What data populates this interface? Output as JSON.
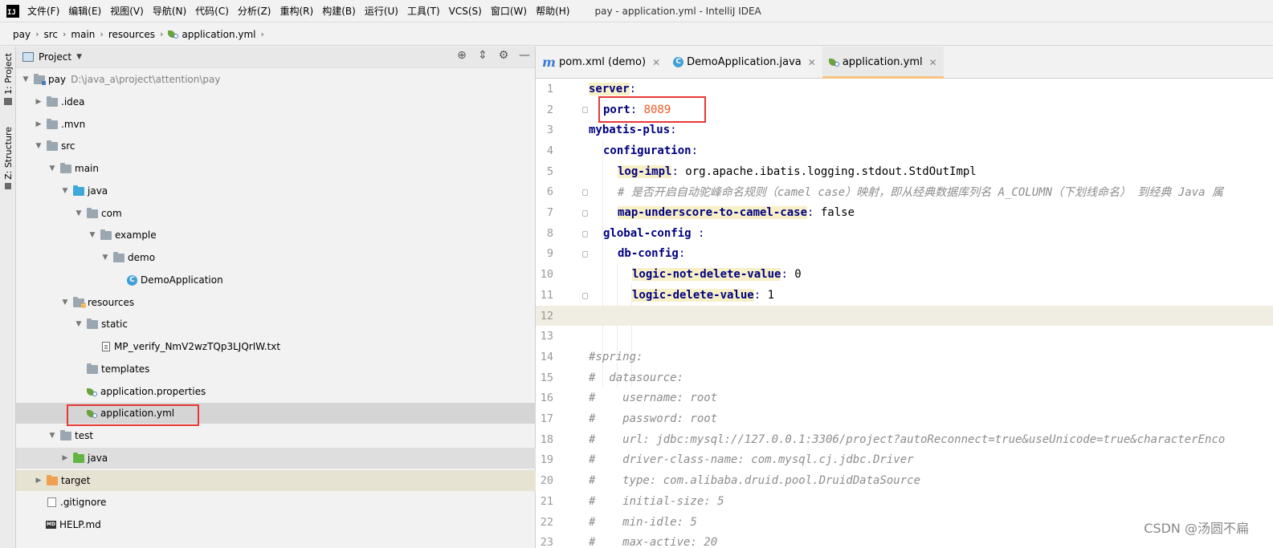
{
  "menubar": {
    "logo": "IJ",
    "items": [
      "文件(F)",
      "编辑(E)",
      "视图(V)",
      "导航(N)",
      "代码(C)",
      "分析(Z)",
      "重构(R)",
      "构建(B)",
      "运行(U)",
      "工具(T)",
      "VCS(S)",
      "窗口(W)",
      "帮助(H)"
    ],
    "window_title": "pay - application.yml - IntelliJ IDEA"
  },
  "breadcrumb": [
    "pay",
    "src",
    "main",
    "resources",
    "application.yml"
  ],
  "tool_stripe": {
    "project": "1: Project",
    "structure": "Z: Structure"
  },
  "project_panel": {
    "title": "Project",
    "tools": [
      "locate-icon",
      "collapse-icon",
      "gear-icon",
      "minimize-icon"
    ],
    "tree": [
      {
        "label": "pay",
        "hint": "D:\\java_a\\project\\attention\\pay"
      },
      {
        "label": ".idea"
      },
      {
        "label": ".mvn"
      },
      {
        "label": "src"
      },
      {
        "label": "main"
      },
      {
        "label": "java"
      },
      {
        "label": "com"
      },
      {
        "label": "example"
      },
      {
        "label": "demo"
      },
      {
        "label": "DemoApplication"
      },
      {
        "label": "resources"
      },
      {
        "label": "static"
      },
      {
        "label": "MP_verify_NmV2wzTQp3LJQrIW.txt"
      },
      {
        "label": "templates"
      },
      {
        "label": "application.properties"
      },
      {
        "label": "application.yml"
      },
      {
        "label": "test"
      },
      {
        "label": "java"
      },
      {
        "label": "target"
      },
      {
        "label": ".gitignore"
      },
      {
        "label": "HELP.md"
      }
    ]
  },
  "editor": {
    "tabs": [
      {
        "label": "pom.xml (demo)"
      },
      {
        "label": "DemoApplication.java"
      },
      {
        "label": "application.yml"
      }
    ],
    "lines": [
      {
        "n": "1",
        "key": "server",
        "rest": ":"
      },
      {
        "n": "2",
        "key": "port",
        "rest": ": ",
        "value": "8089"
      },
      {
        "n": "3",
        "key": "mybatis-plus",
        "rest": ":"
      },
      {
        "n": "4",
        "key": "configuration",
        "rest": ":"
      },
      {
        "n": "5",
        "key": "log-impl",
        "rest": ": ",
        "value": "org.apache.ibatis.logging.stdout.StdOutImpl"
      },
      {
        "n": "6",
        "comment": "# 是否开启自动驼峰命名规则（camel case）映射，即从经典数据库列名 A_COLUMN（下划线命名） 到经典 Java 属"
      },
      {
        "n": "7",
        "key": "map-underscore-to-camel-case",
        "rest": ": ",
        "value": "false"
      },
      {
        "n": "8",
        "key": "global-config",
        "rest": " :"
      },
      {
        "n": "9",
        "key": "db-config",
        "rest": ":"
      },
      {
        "n": "10",
        "key": "logic-not-delete-value",
        "rest": ": ",
        "value": "0"
      },
      {
        "n": "11",
        "key": "logic-delete-value",
        "rest": ": ",
        "value": "1"
      },
      {
        "n": "12"
      },
      {
        "n": "13"
      },
      {
        "n": "14",
        "comment": "#spring:"
      },
      {
        "n": "15",
        "comment": "#  datasource:"
      },
      {
        "n": "16",
        "comment": "#    username: root"
      },
      {
        "n": "17",
        "comment": "#    password: root"
      },
      {
        "n": "18",
        "comment": "#    url: jdbc:mysql://127.0.0.1:3306/project?autoReconnect=true&useUnicode=true&characterEnco"
      },
      {
        "n": "19",
        "comment": "#    driver-class-name: com.mysql.cj.jdbc.Driver"
      },
      {
        "n": "20",
        "comment": "#    type: com.alibaba.druid.pool.DruidDataSource"
      },
      {
        "n": "21",
        "comment": "#    initial-size: 5"
      },
      {
        "n": "22",
        "comment": "#    min-idle: 5"
      },
      {
        "n": "23",
        "comment": "#    max-active: 20"
      }
    ]
  },
  "watermark": "CSDN @汤圆不扁",
  "colors": {
    "key": "#000080",
    "port_value": "#f05a24",
    "comment": "#8c8c8c",
    "annotation_box": "#e53935",
    "active_tab_underline": "#f7c47f"
  }
}
